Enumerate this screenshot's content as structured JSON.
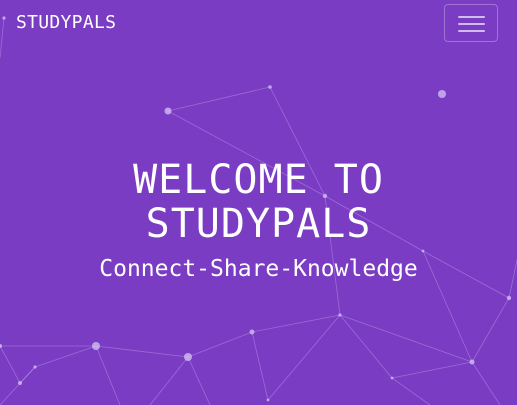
{
  "navbar": {
    "brand": "STUDYPALS",
    "toggler_icon": "hamburger-menu-icon"
  },
  "hero": {
    "title_line1": "WELCOME TO",
    "title_line2": "STUDYPALS",
    "subtitle": "Connect-Share-Knowledge"
  },
  "colors": {
    "background": "#7b3cc4",
    "text": "#ffffff",
    "particles": "#c9b3f0"
  }
}
